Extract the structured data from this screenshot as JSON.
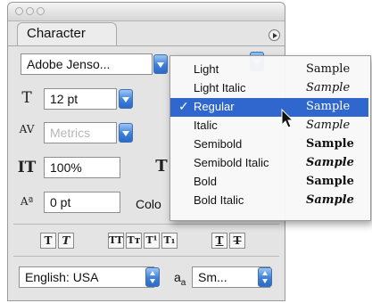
{
  "panel": {
    "tab_label": "Character",
    "font_family": "Adobe Jenso...",
    "font_size": "12 pt",
    "kerning": "Metrics",
    "vertical_scale": "100%",
    "baseline_shift": "0 pt",
    "color_label": "Colo"
  },
  "style_buttons": [
    "T",
    "T",
    "TT",
    "Tт",
    "T¹",
    "T₁",
    "T",
    "T"
  ],
  "bottom": {
    "language": "English: USA",
    "aa_label": "a",
    "aa_sub": "a",
    "antialias": "Sm..."
  },
  "font_style_menu": {
    "selected": "Regular",
    "items": [
      {
        "name": "Light",
        "sample": "Sample"
      },
      {
        "name": "Light Italic",
        "sample": "Sample"
      },
      {
        "name": "Regular",
        "sample": "Sample"
      },
      {
        "name": "Italic",
        "sample": "Sample"
      },
      {
        "name": "Semibold",
        "sample": "Sample"
      },
      {
        "name": "Semibold Italic",
        "sample": "Sample"
      },
      {
        "name": "Bold",
        "sample": "Sample"
      },
      {
        "name": "Bold Italic",
        "sample": "Sample"
      }
    ],
    "check": "✓"
  },
  "colors": {
    "selection": "#2f67cf",
    "aqua_button": "#3d7fd9"
  }
}
